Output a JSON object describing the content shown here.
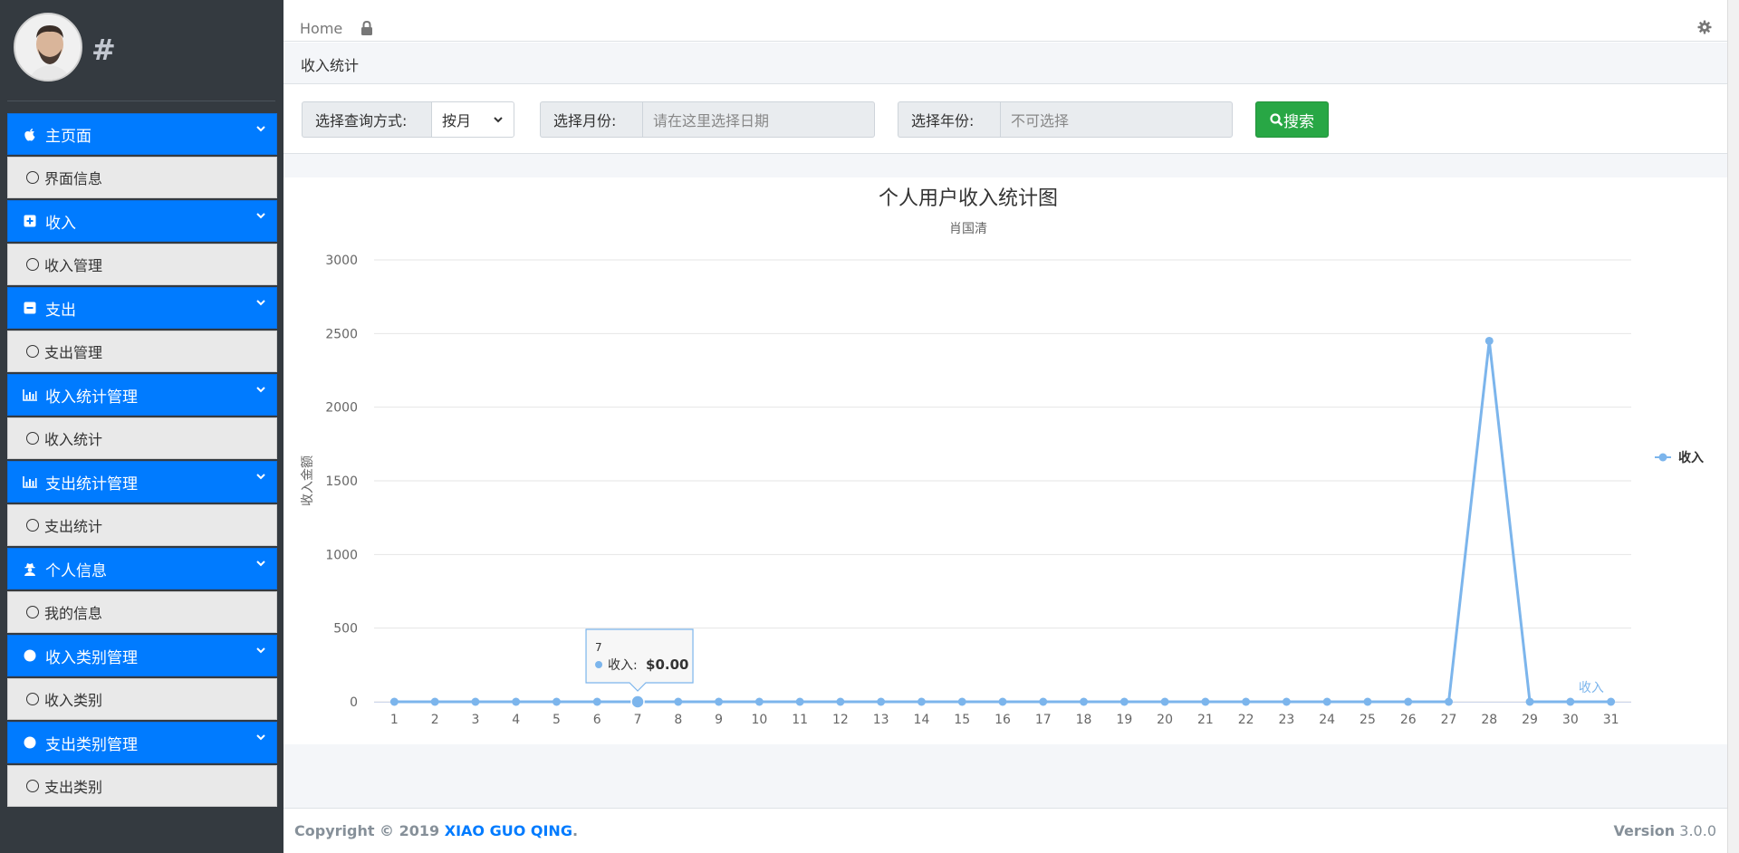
{
  "sidebar": {
    "brand": "#",
    "groups": [
      {
        "label": "主页面",
        "icon": "apple-icon",
        "sub": "界面信息"
      },
      {
        "label": "收入",
        "icon": "plus-square-icon",
        "sub": "收入管理"
      },
      {
        "label": "支出",
        "icon": "minus-square-icon",
        "sub": "支出管理"
      },
      {
        "label": "收入统计管理",
        "icon": "bar-chart-icon",
        "sub": "收入统计"
      },
      {
        "label": "支出统计管理",
        "icon": "bar-chart-icon",
        "sub": "支出统计"
      },
      {
        "label": "个人信息",
        "icon": "user-secret-icon",
        "sub": "我的信息"
      },
      {
        "label": "收入类别管理",
        "icon": "circle-icon",
        "sub": "收入类别"
      },
      {
        "label": "支出类别管理",
        "icon": "circle-icon",
        "sub": "支出类别"
      }
    ]
  },
  "topnav": {
    "home": "Home"
  },
  "breadcrumb": "收入统计",
  "search": {
    "mode_label": "选择查询方式:",
    "mode_value": "按月",
    "month_label": "选择月份:",
    "month_placeholder": "请在这里选择日期",
    "year_label": "选择年份:",
    "year_placeholder": "不可选择",
    "button": "搜索"
  },
  "chart_data": {
    "type": "line",
    "title": "个人用户收入统计图",
    "subtitle": "肖国清",
    "ylabel": "收入金额",
    "ylim": [
      0,
      3000
    ],
    "yticks": [
      0,
      500,
      1000,
      1500,
      2000,
      2500,
      3000
    ],
    "categories": [
      "1",
      "2",
      "3",
      "4",
      "5",
      "6",
      "7",
      "8",
      "9",
      "10",
      "11",
      "12",
      "13",
      "14",
      "15",
      "16",
      "17",
      "18",
      "19",
      "20",
      "21",
      "22",
      "23",
      "24",
      "25",
      "26",
      "27",
      "28",
      "29",
      "30",
      "31"
    ],
    "series": [
      {
        "name": "收入",
        "color": "#7cb5ec",
        "values": [
          0,
          0,
          0,
          0,
          0,
          0,
          0,
          0,
          0,
          0,
          0,
          0,
          0,
          0,
          0,
          0,
          0,
          0,
          0,
          0,
          0,
          0,
          0,
          0,
          0,
          0,
          0,
          2450,
          0,
          0,
          0
        ]
      }
    ],
    "legend": "right",
    "series_end_label": "收入",
    "tooltip": {
      "category": "7",
      "series": "收入",
      "value": "$0.00"
    }
  },
  "footer": {
    "copyright_prefix": "Copyright © 2019 ",
    "copyright_link": "XIAO GUO QING",
    "copyright_suffix": ".",
    "version_label": "Version",
    "version_value": "3.0.0"
  }
}
